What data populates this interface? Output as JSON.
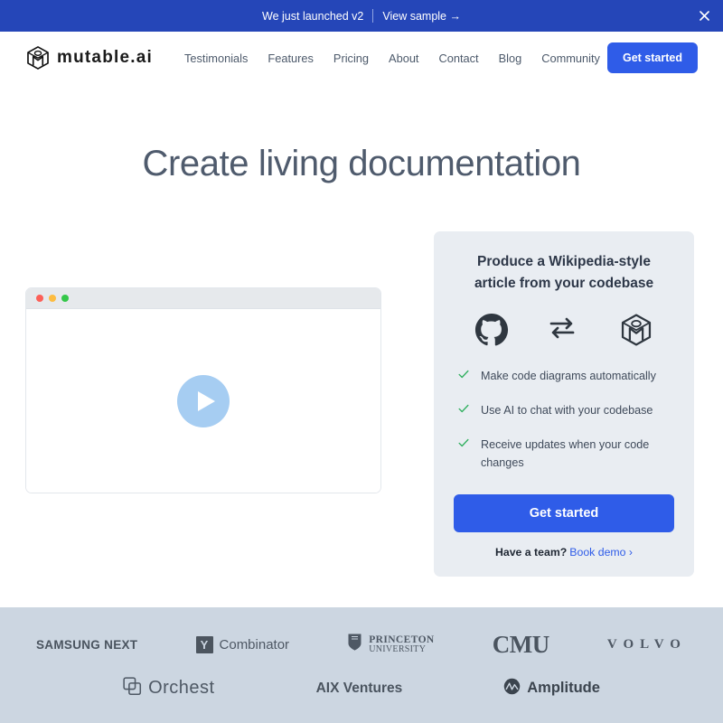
{
  "banner": {
    "message": "We just launched v2",
    "link_label": "View sample →",
    "close_icon": "close-icon"
  },
  "header": {
    "brand_name": "mutable.ai",
    "brand_icon": "mutable-cube-logo-icon",
    "nav": [
      {
        "label": "Testimonials"
      },
      {
        "label": "Features"
      },
      {
        "label": "Pricing"
      },
      {
        "label": "About"
      },
      {
        "label": "Contact"
      },
      {
        "label": "Blog"
      },
      {
        "label": "Community"
      }
    ],
    "cta_label": "Get started"
  },
  "hero": {
    "title": "Create living documentation"
  },
  "video": {
    "play_icon": "play-icon",
    "window_dots": [
      "red",
      "yellow",
      "green"
    ]
  },
  "card": {
    "title": "Produce a Wikipedia-style article from your codebase",
    "icons": [
      {
        "name": "github-icon"
      },
      {
        "name": "sync-arrows-icon"
      },
      {
        "name": "mutable-cube-logo-icon"
      }
    ],
    "bullets": [
      {
        "text": "Make code diagrams automatically"
      },
      {
        "text": "Use AI to chat with your codebase"
      },
      {
        "text": "Receive updates when your code changes"
      }
    ],
    "cta_label": "Get started",
    "team_label": "Have a team?",
    "demo_link": "Book demo ›"
  },
  "logos": {
    "row1": [
      {
        "name": "samsung-next",
        "text": "SAMSUNG NEXT"
      },
      {
        "name": "y-combinator",
        "badge": "Y",
        "text": "Combinator"
      },
      {
        "name": "princeton-university",
        "line1": "PRINCETON",
        "line2": "UNIVERSITY"
      },
      {
        "name": "cmu",
        "text": "CMU"
      },
      {
        "name": "volvo",
        "text": "VOLVO"
      }
    ],
    "row2": [
      {
        "name": "orchest",
        "text": "Orchest"
      },
      {
        "name": "aix-ventures",
        "text": "AIX Ventures"
      },
      {
        "name": "amplitude",
        "text": "Amplitude"
      }
    ]
  },
  "colors": {
    "banner_bg": "#2546b8",
    "accent_blue": "#2f5ce8",
    "heading": "#4f5b6d",
    "card_bg": "#e9edf2",
    "logos_bg": "#ccd6e1",
    "check_green": "#2faf5e",
    "play_blue": "#a6cdf2"
  }
}
